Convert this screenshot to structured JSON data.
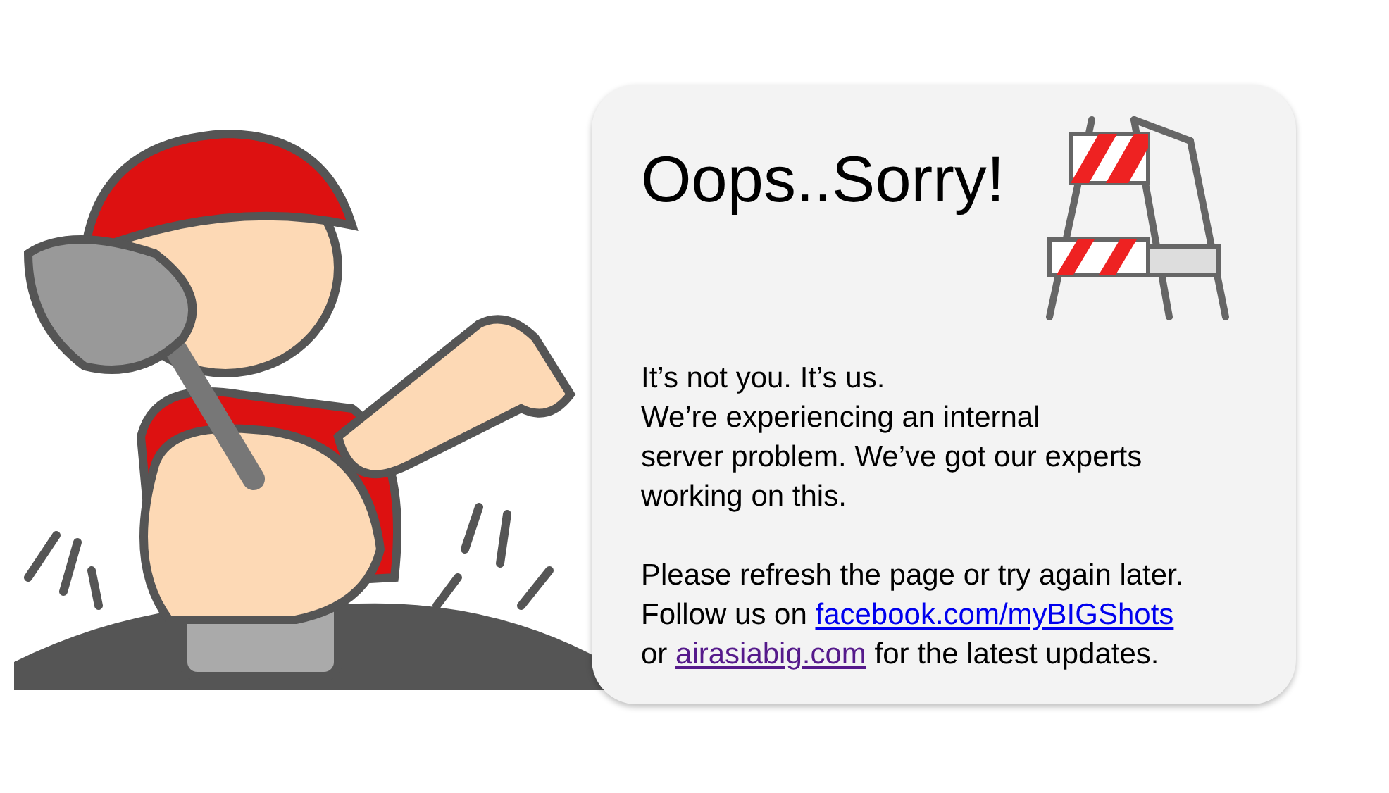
{
  "card": {
    "title": "Oops..Sorry!",
    "paragraphs": [
      {
        "lines": [
          [
            {
              "kind": "text",
              "text": "It’s not you. It’s us."
            }
          ],
          [
            {
              "kind": "text",
              "text": "We’re experiencing an internal"
            }
          ],
          [
            {
              "kind": "text",
              "text": "server problem. We’ve got our experts"
            }
          ],
          [
            {
              "kind": "text",
              "text": "working on this."
            }
          ]
        ]
      },
      {
        "lines": [
          [
            {
              "kind": "text",
              "text": "Please refresh the page or try again later."
            }
          ],
          [
            {
              "kind": "text",
              "text": "Follow us on "
            },
            {
              "kind": "link",
              "text": "facebook.com/myBIGShots",
              "visited": false
            }
          ],
          [
            {
              "kind": "text",
              "text": "or "
            },
            {
              "kind": "link",
              "text": "airasiabig.com",
              "visited": true
            },
            {
              "kind": "text",
              "text": " for the latest updates."
            }
          ]
        ]
      }
    ]
  }
}
